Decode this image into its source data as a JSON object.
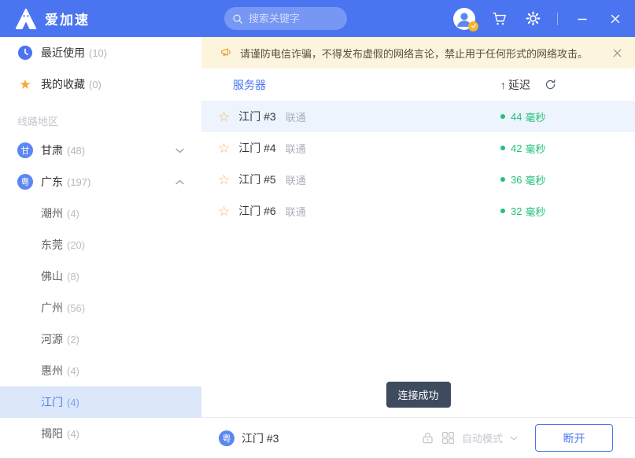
{
  "topbar": {
    "app_name": "爱加速",
    "search_placeholder": "搜索关键字"
  },
  "banner": {
    "text": "请谨防电信诈骗，不得发布虚假的网络言论，禁止用于任何形式的网络攻击。"
  },
  "sidebar": {
    "quick": [
      {
        "label": "最近使用",
        "count": "(10)"
      },
      {
        "label": "我的收藏",
        "count": "(0)"
      }
    ],
    "section_label": "线路地区",
    "regions": [
      {
        "badge": "甘",
        "label": "甘肃",
        "count": "(48)",
        "state": "collapsed"
      },
      {
        "badge": "粤",
        "label": "广东",
        "count": "(197)",
        "state": "expanded"
      }
    ],
    "cities": [
      {
        "label": "潮州",
        "count": "(4)"
      },
      {
        "label": "东莞",
        "count": "(20)"
      },
      {
        "label": "佛山",
        "count": "(8)"
      },
      {
        "label": "广州",
        "count": "(56)"
      },
      {
        "label": "河源",
        "count": "(2)"
      },
      {
        "label": "惠州",
        "count": "(4)"
      },
      {
        "label": "江门",
        "count": "(4)",
        "selected": true
      },
      {
        "label": "揭阳",
        "count": "(4)"
      }
    ]
  },
  "server_list": {
    "columns": {
      "server": "服务器",
      "latency": "延迟",
      "sort_arrow": "↑"
    },
    "rows": [
      {
        "name": "江门 #3",
        "carrier": "联通",
        "latency": "44",
        "unit": "毫秒",
        "selected": true
      },
      {
        "name": "江门 #4",
        "carrier": "联通",
        "latency": "42",
        "unit": "毫秒"
      },
      {
        "name": "江门 #5",
        "carrier": "联通",
        "latency": "36",
        "unit": "毫秒"
      },
      {
        "name": "江门 #6",
        "carrier": "联通",
        "latency": "32",
        "unit": "毫秒"
      }
    ]
  },
  "toast": {
    "text": "连接成功"
  },
  "statusbar": {
    "badge": "粤",
    "current_server": "江门 #3",
    "mode_label": "自动模式",
    "disconnect_label": "断开"
  },
  "colors": {
    "topbar_blue": "#4A74F0",
    "latency_green": "#21C179",
    "banner_bg": "#FCF4DC",
    "selected_row_bg": "#EDF4FD",
    "selected_city_bg": "#DCE8F9",
    "toast_bg": "#3E4B5F"
  }
}
